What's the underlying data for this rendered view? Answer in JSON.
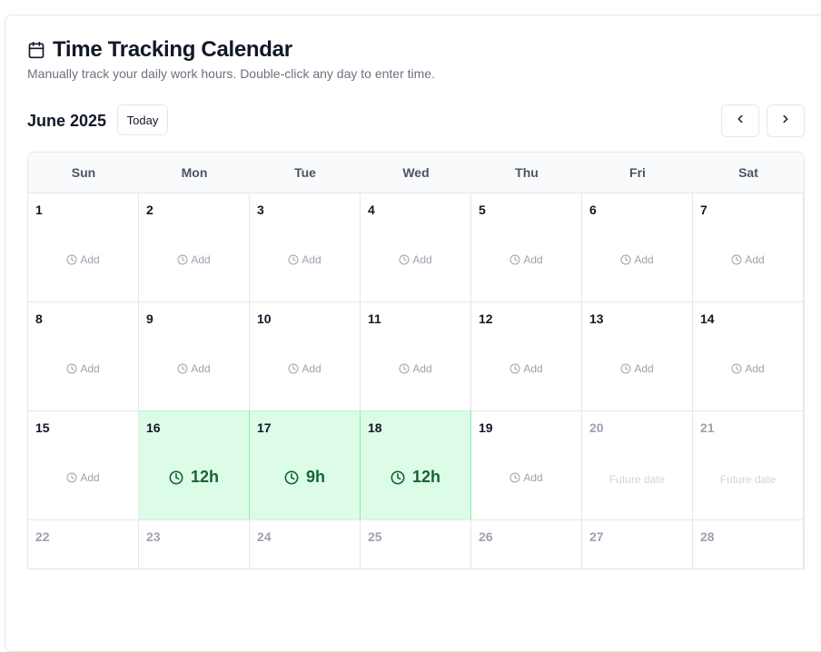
{
  "header": {
    "title": "Time Tracking Calendar",
    "subtitle": "Manually track your daily work hours. Double-click any day to enter time.",
    "icon": "calendar-icon"
  },
  "toolbar": {
    "month_label": "June 2025",
    "today_label": "Today",
    "prev_icon": "chevron-left-icon",
    "next_icon": "chevron-right-icon"
  },
  "weekdays": [
    "Sun",
    "Mon",
    "Tue",
    "Wed",
    "Thu",
    "Fri",
    "Sat"
  ],
  "add_label": "Add",
  "future_label": "Future date",
  "colors": {
    "tracked_bg": "#dcfce7",
    "tracked_text": "#166534",
    "muted_text": "#9ca3af"
  },
  "days": [
    {
      "day": "1",
      "state": "add"
    },
    {
      "day": "2",
      "state": "add"
    },
    {
      "day": "3",
      "state": "add"
    },
    {
      "day": "4",
      "state": "add"
    },
    {
      "day": "5",
      "state": "add"
    },
    {
      "day": "6",
      "state": "add"
    },
    {
      "day": "7",
      "state": "add"
    },
    {
      "day": "8",
      "state": "add"
    },
    {
      "day": "9",
      "state": "add"
    },
    {
      "day": "10",
      "state": "add"
    },
    {
      "day": "11",
      "state": "add"
    },
    {
      "day": "12",
      "state": "add"
    },
    {
      "day": "13",
      "state": "add"
    },
    {
      "day": "14",
      "state": "add"
    },
    {
      "day": "15",
      "state": "add"
    },
    {
      "day": "16",
      "state": "tracked",
      "hours": "12h"
    },
    {
      "day": "17",
      "state": "tracked",
      "hours": "9h"
    },
    {
      "day": "18",
      "state": "tracked",
      "hours": "12h"
    },
    {
      "day": "19",
      "state": "add"
    },
    {
      "day": "20",
      "state": "future"
    },
    {
      "day": "21",
      "state": "future"
    },
    {
      "day": "22",
      "state": "future"
    },
    {
      "day": "23",
      "state": "future"
    },
    {
      "day": "24",
      "state": "future"
    },
    {
      "day": "25",
      "state": "future"
    },
    {
      "day": "26",
      "state": "future"
    },
    {
      "day": "27",
      "state": "future"
    },
    {
      "day": "28",
      "state": "future"
    }
  ]
}
